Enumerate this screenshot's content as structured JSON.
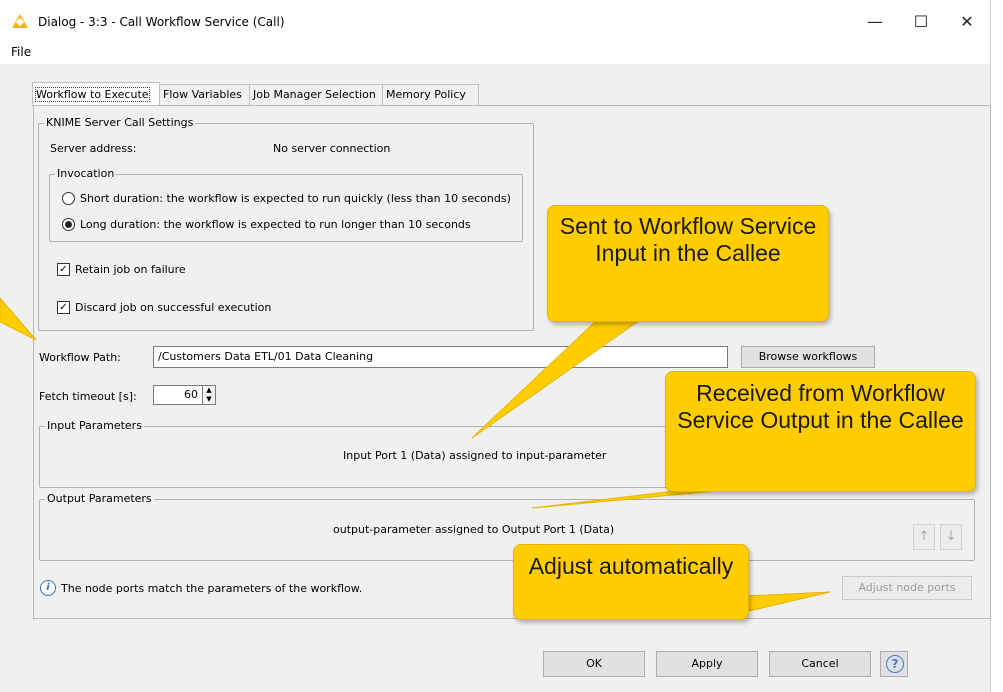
{
  "window": {
    "title": "Dialog - 3:3 - Call Workflow Service (Call)",
    "controls": {
      "minimize": "—",
      "maximize": "☐",
      "close": "✕"
    }
  },
  "menu": {
    "file": "File"
  },
  "tabs": [
    {
      "label": "Workflow to Execute",
      "active": true
    },
    {
      "label": "Flow Variables",
      "active": false
    },
    {
      "label": "Job Manager Selection",
      "active": false
    },
    {
      "label": "Memory Policy",
      "active": false
    }
  ],
  "server_settings": {
    "legend": "KNIME Server Call Settings",
    "server_address_label": "Server address:",
    "server_address_value": "No server connection",
    "invocation": {
      "legend": "Invocation",
      "options": [
        {
          "label": "Short duration: the workflow is expected to run quickly (less than 10 seconds)",
          "selected": false
        },
        {
          "label": "Long duration: the workflow is expected to run longer than 10 seconds",
          "selected": true
        }
      ]
    },
    "retain_job": {
      "label": "Retain job on failure",
      "checked": true
    },
    "discard_job": {
      "label": "Discard job on successful execution",
      "checked": true
    }
  },
  "workflow_path": {
    "label": "Workflow Path:",
    "value": "/Customers Data ETL/01 Data Cleaning",
    "browse_label": "Browse workflows"
  },
  "fetch_timeout": {
    "label": "Fetch timeout [s]:",
    "value": "60"
  },
  "input_parameters": {
    "legend": "Input Parameters",
    "text": "Input Port 1 (Data) assigned to input-parameter"
  },
  "output_parameters": {
    "legend": "Output Parameters",
    "text": "output-parameter assigned to Output Port 1 (Data)",
    "up": "↑",
    "down": "↓"
  },
  "ports_status": {
    "text": "The node ports match the parameters of the workflow.",
    "adjust_label": "Adjust node ports"
  },
  "footer": {
    "ok": "OK",
    "apply": "Apply",
    "cancel": "Cancel",
    "help": "?"
  },
  "callouts": {
    "sent": "Sent to Workflow Service Input in the Callee",
    "received": "Received from Workflow Service Output in the Callee",
    "adjust": "Adjust automatically"
  },
  "colors": {
    "callout": "#ffcd00",
    "accent": "#3a7bd5",
    "logo": "#f7b500"
  }
}
